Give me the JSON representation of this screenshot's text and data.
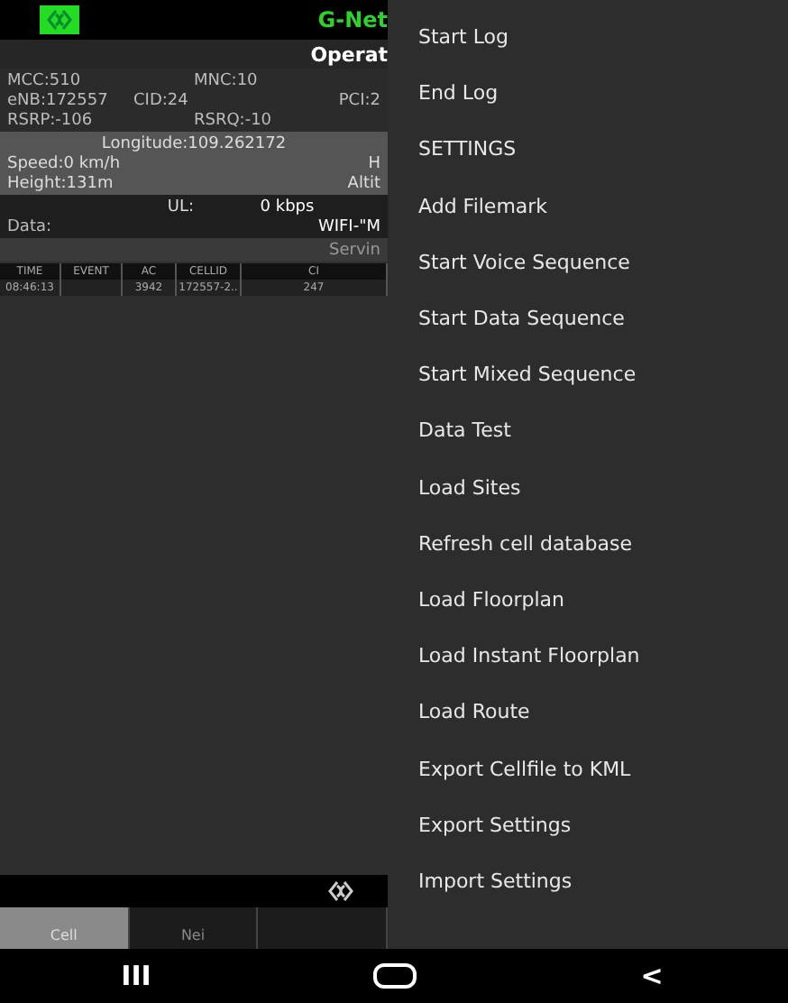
{
  "app": {
    "title": "G-Net",
    "operator": "Operat",
    "info_rows": [
      [
        "MCC:510",
        "MNC:10"
      ],
      [
        "eNB:172557",
        "CID:24",
        "PCI:2"
      ],
      [
        "RSRP:-106",
        "RSRQ:-10"
      ]
    ],
    "location_rows": [
      [
        "Longitude:109.262172"
      ],
      [
        "Speed:0 km/h",
        "H"
      ],
      [
        "Height:131m",
        "Altit"
      ]
    ],
    "ul_label": "UL:",
    "ul_value": "0 kbps",
    "data_label": "Data:",
    "data_value": "WIFI-\"M",
    "serving": "Servin",
    "table": {
      "columns": [
        "TIME",
        "EVENT",
        "AC",
        "CELLID",
        "CI"
      ],
      "rows": [
        [
          "08:46:13",
          "",
          "3942",
          "172557-2..",
          "247"
        ]
      ]
    },
    "tabs": [
      {
        "label": "Cell",
        "selected": true
      },
      {
        "label": "Nei",
        "selected": false
      },
      {
        "selected": false
      }
    ]
  },
  "menu": {
    "items": [
      "Start Log",
      "End Log",
      "SETTINGS",
      "Add Filemark",
      "Start Voice Sequence",
      "Start Data Sequence",
      "Start Mixed Sequence",
      "Data Test",
      "Load Sites",
      "Refresh cell database",
      "Load Floorplan",
      "Load Instant Floorplan",
      "Load Route",
      "Export Cellfile to KML",
      "Export Settings",
      "Import Settings"
    ]
  },
  "nav": {
    "recents": "III",
    "back": "<"
  }
}
